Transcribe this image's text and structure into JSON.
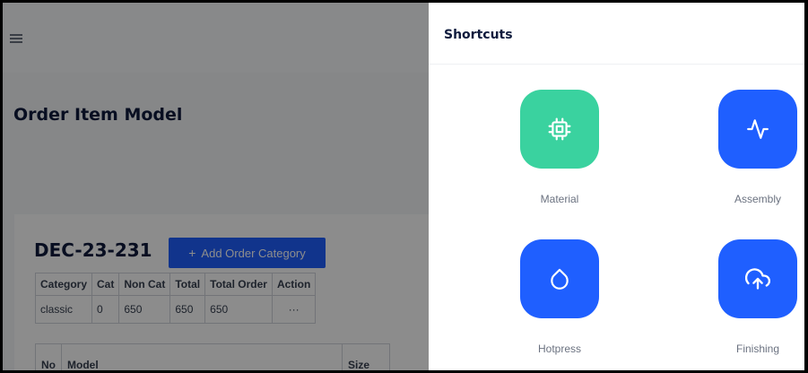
{
  "page": {
    "title": "Order Item Model",
    "order_code": "DEC-23-231",
    "add_button_label": "Add Order Category",
    "category_table": {
      "headers": [
        "Category",
        "Cat",
        "Non Cat",
        "Total",
        "Total Order",
        "Action"
      ],
      "rows": [
        [
          "classic",
          "0",
          "650",
          "650",
          "650",
          "···"
        ]
      ]
    },
    "model_table": {
      "headers": [
        "No",
        "Model",
        "Size"
      ]
    }
  },
  "shortcuts": {
    "title": "Shortcuts",
    "items": [
      {
        "label": "Material",
        "icon": "chip-icon",
        "color": "#3ad29f"
      },
      {
        "label": "Assembly",
        "icon": "activity-icon",
        "color": "#1f5fff"
      },
      {
        "label": "Hotpress",
        "icon": "droplet-icon",
        "color": "#1f5fff"
      },
      {
        "label": "Finishing",
        "icon": "upload-cloud-icon",
        "color": "#1f5fff"
      }
    ]
  }
}
